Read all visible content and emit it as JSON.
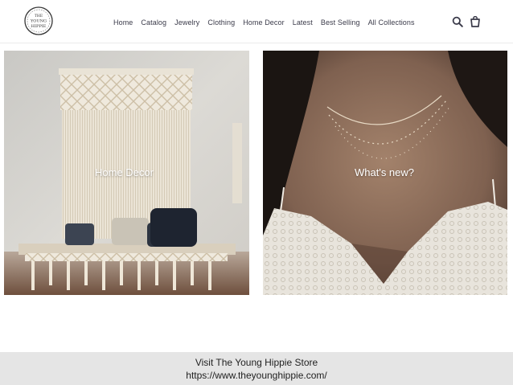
{
  "logo": {
    "text_line1": "THE",
    "text_line2": "YOUNG",
    "text_line3": "HIPPIE"
  },
  "nav": {
    "items": [
      {
        "label": "Home"
      },
      {
        "label": "Catalog"
      },
      {
        "label": "Jewelry"
      },
      {
        "label": "Clothing"
      },
      {
        "label": "Home Decor"
      },
      {
        "label": "Latest"
      },
      {
        "label": "Best Selling"
      },
      {
        "label": "All Collections"
      }
    ],
    "search_icon": "search-icon",
    "cart_icon": "cart-icon"
  },
  "tiles": {
    "left": {
      "label": "Home Decor"
    },
    "right": {
      "label": "What's new?"
    }
  },
  "caption": {
    "line1": "Visit The Young Hippie Store",
    "line2": "https://www.theyounghippie.com/"
  }
}
